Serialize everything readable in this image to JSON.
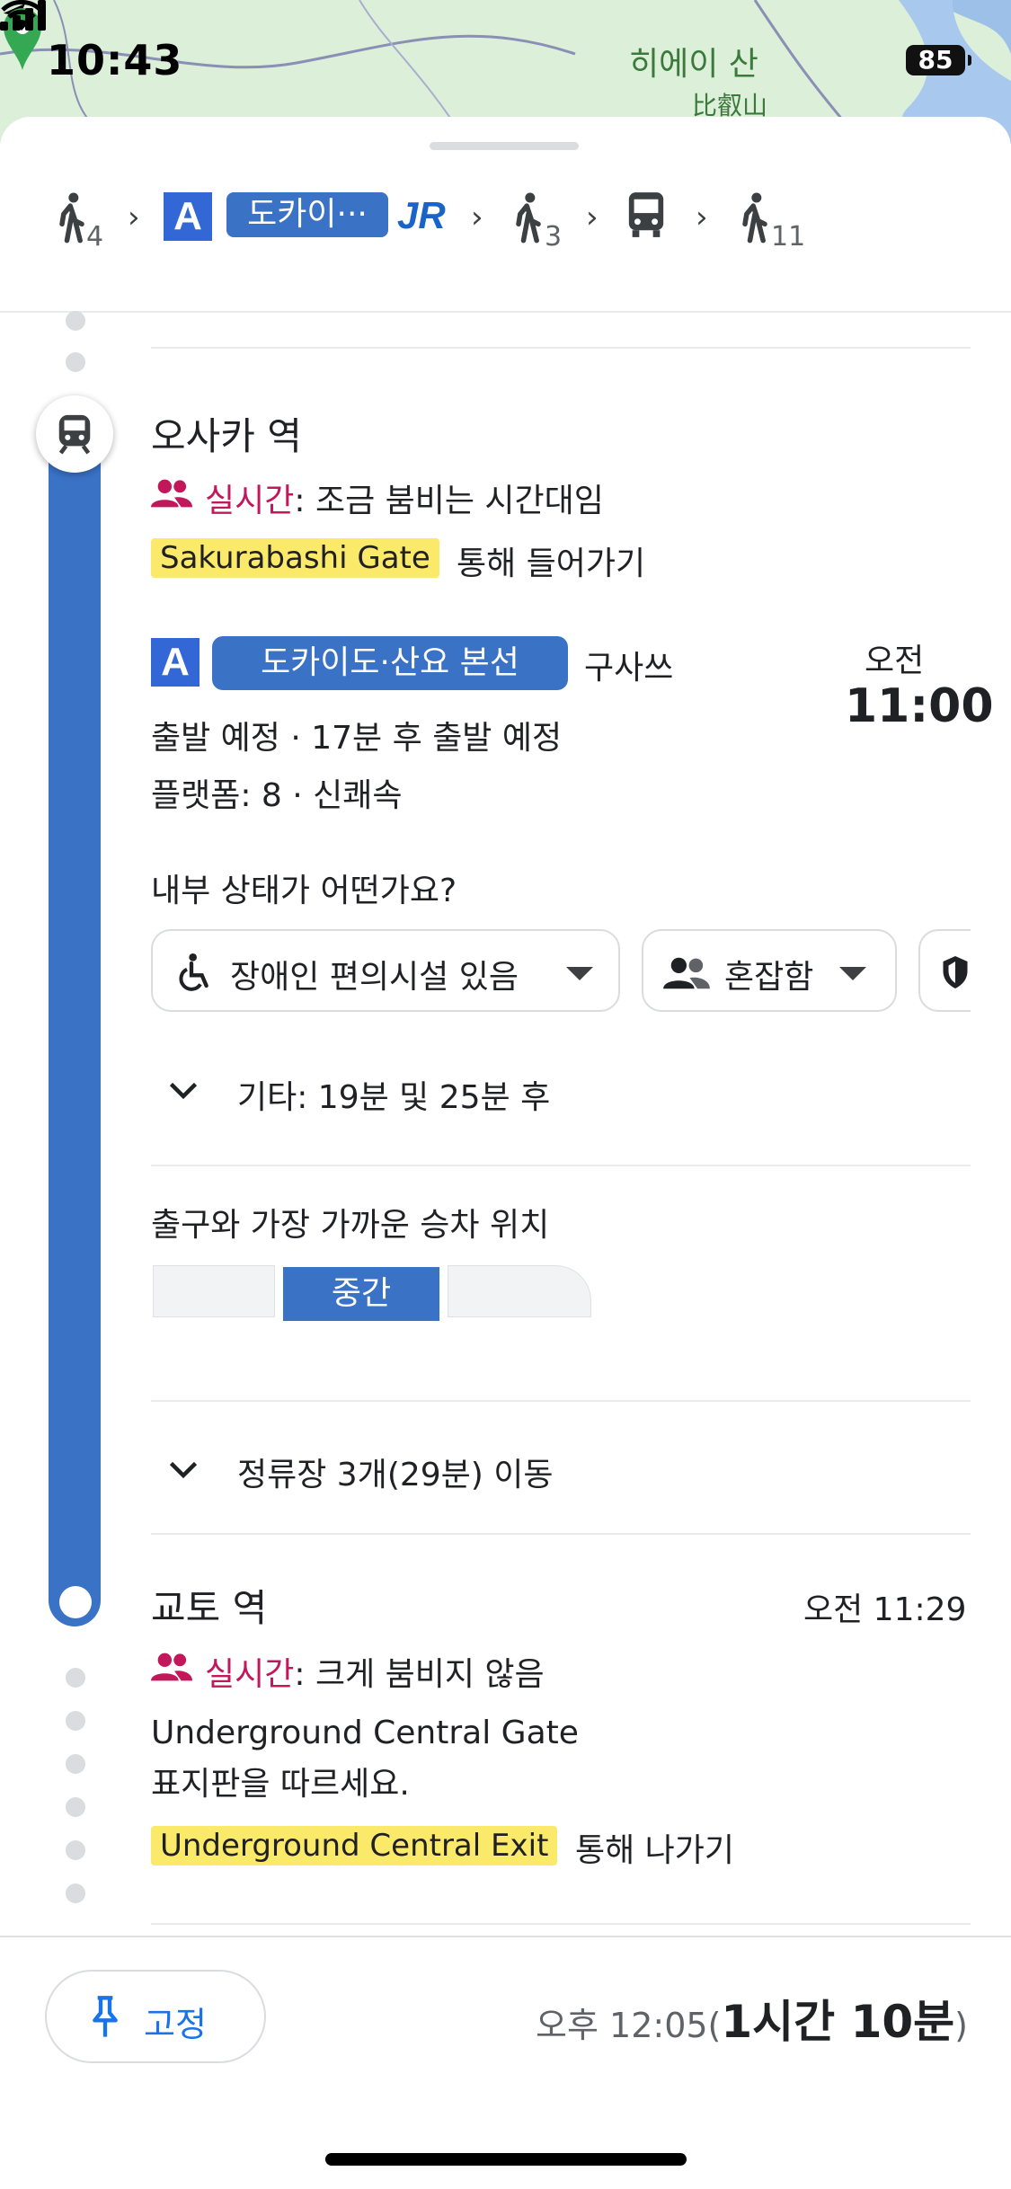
{
  "status_bar": {
    "time": "10:43",
    "battery": "85"
  },
  "map": {
    "label_ko": "히에이 산",
    "label_jp": "比叡山"
  },
  "route_summary": {
    "walk_1": "4",
    "line_badge": "A",
    "line_short": "도카이···",
    "operator_logo": "JR",
    "walk_2": "3",
    "walk_3": "11",
    "icons": [
      "walk-icon",
      "chevron-right-icon",
      "train-line-badge",
      "jr-logo",
      "chevron-right-icon",
      "walk-icon",
      "chevron-right-icon",
      "bus-icon",
      "chevron-right-icon",
      "walk-icon"
    ]
  },
  "departure": {
    "station": "오사카 역",
    "realtime_label": "실시간",
    "realtime_status": ": 조금 붐비는 시간대임",
    "gate_name": "Sakurabashi Gate",
    "gate_suffix": "통해 들어가기",
    "line_badge": "A",
    "line_name": "도카이도·산요 본선",
    "direction": "구사쓰",
    "time_ampm": "오전",
    "time": "11:00",
    "schedule": "출발 예정 · 17분 후 출발 예정",
    "platform": "플랫폼: 8 · 신쾌속",
    "question": "내부 상태가 어떤가요?",
    "chips": {
      "accessibility": "장애인 편의시설 있음",
      "crowd": "혼잡함"
    },
    "other_departures": "기타: 19분 및 25분 후",
    "boarding_title": "출구와 가장 가까운 승차 위치",
    "boarding_position": "중간",
    "stops": "정류장 3개(29분) 이동"
  },
  "arrival_stop": {
    "station": "교토 역",
    "time": "오전 11:29",
    "realtime_label": "실시간",
    "realtime_status": ": 크게 붐비지 않음",
    "gate_line1": "Underground Central Gate",
    "gate_line2": "표지판을 따르세요.",
    "exit_name": "Underground Central Exit",
    "exit_suffix": "통해 나가기"
  },
  "bottom_bar": {
    "pin_label": "고정",
    "arrival_time": "오후 12:05(",
    "duration": "1시간 10분",
    "close_paren": ")"
  },
  "colors": {
    "accent_blue": "#3a72c6",
    "realtime_pink": "#c2185b",
    "highlight_yellow": "#fbe96a",
    "link_blue": "#1a73e8"
  }
}
